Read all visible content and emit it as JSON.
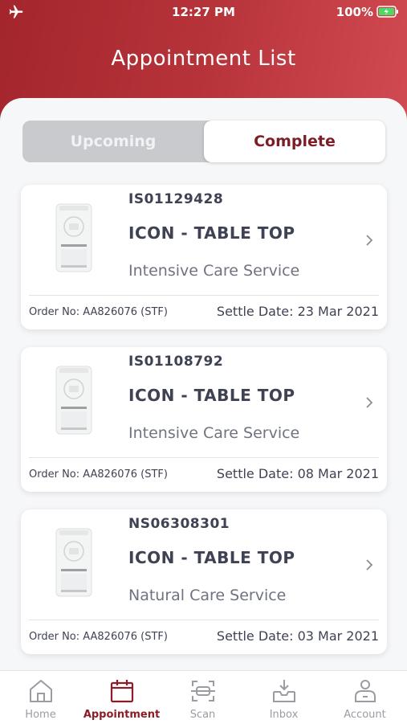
{
  "status_bar": {
    "time": "12:27 PM",
    "battery": "100%"
  },
  "header": {
    "title": "Appointment List"
  },
  "segments": {
    "upcoming": "Upcoming",
    "complete": "Complete",
    "selected": "Complete"
  },
  "appointments": [
    {
      "code": "IS01129428",
      "product": "ICON - TABLE TOP",
      "service": "Intensive Care Service",
      "order": "Order No: AA826076 (STF)",
      "settle": "Settle Date: 23 Mar 2021"
    },
    {
      "code": "IS01108792",
      "product": "ICON - TABLE TOP",
      "service": "Intensive Care Service",
      "order": "Order No: AA826076 (STF)",
      "settle": "Settle Date: 08 Mar 2021"
    },
    {
      "code": "NS06308301",
      "product": "ICON - TABLE TOP",
      "service": "Natural Care Service",
      "order": "Order No: AA826076 (STF)",
      "settle": "Settle Date: 03 Mar 2021"
    }
  ],
  "tabbar": {
    "items": [
      {
        "label": "Home",
        "icon": "home-icon"
      },
      {
        "label": "Appointment",
        "icon": "calendar-icon"
      },
      {
        "label": "Scan",
        "icon": "scan-icon"
      },
      {
        "label": "Inbox",
        "icon": "inbox-icon"
      },
      {
        "label": "Account",
        "icon": "account-icon"
      }
    ],
    "active": "Appointment"
  },
  "colors": {
    "brand": "#a3262c",
    "active_tab": "#8c1d27",
    "text_dark": "#3f4253"
  }
}
